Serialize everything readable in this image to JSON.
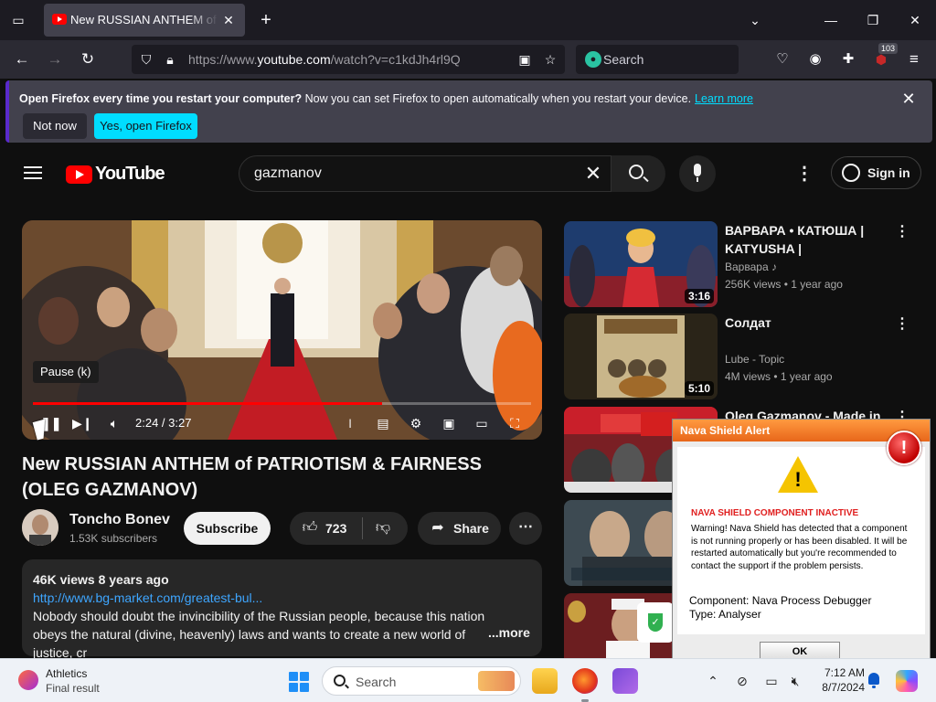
{
  "browser": {
    "tab": {
      "title": "New RUSSIAN ANTHEM of PATRIOTISM & FAIRNESS (OLEG GAZMANOV)"
    },
    "url": {
      "prefix": "https://www.",
      "host": "youtube.com",
      "path": "/watch?v=c1kdJh4rl9Q"
    },
    "search_placeholder": "Search",
    "extensions_badge": "103"
  },
  "notification": {
    "bold": "Open Firefox every time you restart your computer?",
    "text": "Now you can set Firefox to open automatically when you restart your device.",
    "link": "Learn more",
    "not_now": "Not now",
    "yes": "Yes, open Firefox"
  },
  "youtube": {
    "logo_text": "YouTube",
    "search_query": "gazmanov",
    "sign_in": "Sign in"
  },
  "player": {
    "tooltip": "Pause (k)",
    "time": "2:24 / 3:27",
    "progress": 0.7
  },
  "video": {
    "title": "New RUSSIAN ANTHEM of PATRIOTISM & FAIRNESS (OLEG GAZMANOV)",
    "channel": "Toncho Bonev",
    "subscribers": "1.53K subscribers",
    "subscribe": "Subscribe",
    "likes": "723",
    "share": "Share",
    "description": {
      "meta": "46K views  8 years ago",
      "link": "http://www.bg-market.com/greatest-bul...",
      "text": "Nobody should doubt the invincibility of the Russian people, because this nation obeys the natural (divine, heavenly) laws and wants to create a new world of justice, cr",
      "more": "...more"
    }
  },
  "recommendations": [
    {
      "title": "ВАРВАРА • КАТЮША | KATYUSHA | Славянский...",
      "channel": "Варвара ♪",
      "meta": "256K views  •  1 year ago",
      "duration": "3:16"
    },
    {
      "title": "Солдат",
      "channel": "Lube - Topic",
      "meta": "4M views  •  1 year ago",
      "duration": "5:10"
    },
    {
      "title": "Oleg Gazmanov - Made in",
      "channel": "",
      "meta": "",
      "duration": ""
    }
  ],
  "alert": {
    "title": "Nava Shield Alert",
    "close": "!",
    "heading": "NAVA SHIELD COMPONENT INACTIVE",
    "message": "Warning! Nava Shield has detected that a component is not running properly or has been disabled. It will be restarted automatically but you're recommended to contact the support if the problem persists.",
    "component": "Component: Nava Process Debugger",
    "type": "Type: Analyser",
    "ok": "OK"
  },
  "taskbar": {
    "weather_title": "Athletics",
    "weather_sub": "Final result",
    "search": "Search",
    "time": "7:12 AM",
    "date": "8/7/2024"
  }
}
